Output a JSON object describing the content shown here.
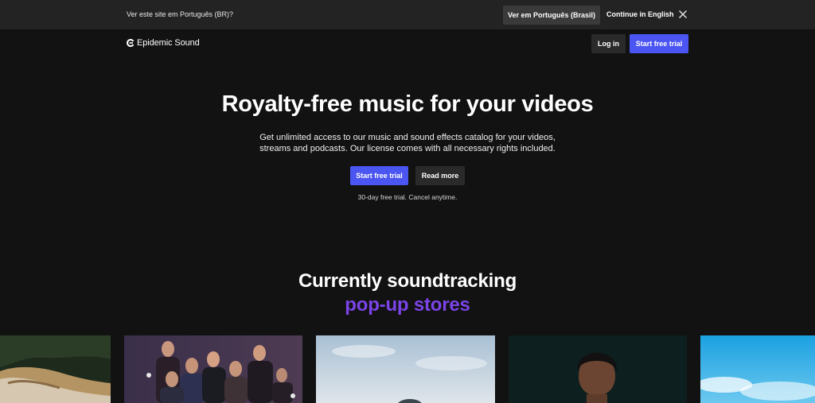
{
  "locale_bar": {
    "prompt": "Ver este site em Português (BR)?",
    "switch_label": "Ver em Português (Brasil)",
    "continue_label": "Continue in English",
    "close_icon": "close-icon"
  },
  "header": {
    "brand": "Epidemic Sound",
    "login_label": "Log in",
    "trial_label": "Start free trial"
  },
  "hero": {
    "title": "Royalty-free music for your videos",
    "subtitle_line1": "Get unlimited access to our music and sound effects catalog for your videos,",
    "subtitle_line2": "streams and podcasts. Our license comes with all necessary rights included.",
    "primary_label": "Start free trial",
    "secondary_label": "Read more",
    "note": "30-day free trial. Cancel anytime."
  },
  "section": {
    "title": "Currently soundtracking",
    "accent": "pop-up stores"
  },
  "colors": {
    "background": "#121212",
    "locale_bar": "#232323",
    "primary": "#4a55f2",
    "accent": "#7b44e8",
    "secondary_button": "#2a2a2a"
  }
}
